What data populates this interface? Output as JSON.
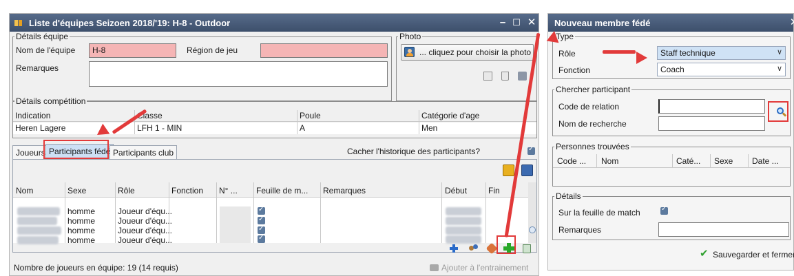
{
  "left_window": {
    "title": "Liste d'équipes Seizoen 2018/'19: H-8 - Outdoor",
    "controls": {
      "minimize": "–",
      "maximize": "☐",
      "close": "✕"
    },
    "team_details": {
      "legend": "Détails équipe",
      "team_name_label": "Nom de l'équipe",
      "team_name_value": "H-8",
      "region_label": "Région de jeu",
      "region_value": "",
      "remarks_label": "Remarques",
      "remarks_value": ""
    },
    "photo": {
      "legend": "Photo",
      "choose_label": "... cliquez pour choisir la photo"
    },
    "competition": {
      "legend": "Détails compétition",
      "headers": [
        "Indication",
        "Classe",
        "Poule",
        "Catégorie d'age"
      ],
      "row": [
        "Heren Lagere",
        "LFH 1  - MIN",
        "A",
        "Men"
      ]
    },
    "tabs": [
      "Joueurs",
      "Participants fédé",
      "Participants club"
    ],
    "active_tab": "Participants fédé",
    "hide_history_label": "Cacher l'historique des participants?",
    "hide_history_checked": true,
    "table": {
      "headers": [
        "Nom",
        "Sexe",
        "Rôle",
        "Fonction",
        "N° ...",
        "Feuille de m...",
        "Remarques",
        "Début",
        "Fin"
      ],
      "rows": [
        {
          "sexe": "homme",
          "role": "Joueur d'équ...",
          "feuille": true
        },
        {
          "sexe": "homme",
          "role": "Joueur d'équ...",
          "feuille": true
        },
        {
          "sexe": "homme",
          "role": "Joueur d'équ...",
          "feuille": true
        },
        {
          "sexe": "homme",
          "role": "Joueur d'équ...",
          "feuille": true
        }
      ]
    },
    "footer": {
      "player_count": "Nombre de joueurs en équipe: 19 (14 requis)",
      "add_training": "Ajouter à l'entrainement"
    }
  },
  "right_window": {
    "title": "Nouveau membre fédé",
    "type": {
      "legend": "Type",
      "role_label": "Rôle",
      "role_value": "Staff technique",
      "function_label": "Fonction",
      "function_value": "Coach"
    },
    "search": {
      "legend": "Chercher participant",
      "relation_code_label": "Code de relation",
      "relation_code_value": "",
      "search_name_label": "Nom de recherche",
      "search_name_value": ""
    },
    "found": {
      "legend": "Personnes trouvées",
      "headers": [
        "Code ...",
        "Nom",
        "Caté...",
        "Sexe",
        "Date ..."
      ]
    },
    "details": {
      "legend": "Détails",
      "on_sheet_label": "Sur la feuille de match",
      "on_sheet_checked": true,
      "remarks_label": "Remarques",
      "remarks_value": ""
    },
    "save_close_label": "Sauvegarder et fermer"
  },
  "colors": {
    "title_bar": "#4a5d7c",
    "highlight_pink": "#f5b5b5",
    "annotation_red": "#e23a3a",
    "active_tab": "#cde0f4"
  }
}
